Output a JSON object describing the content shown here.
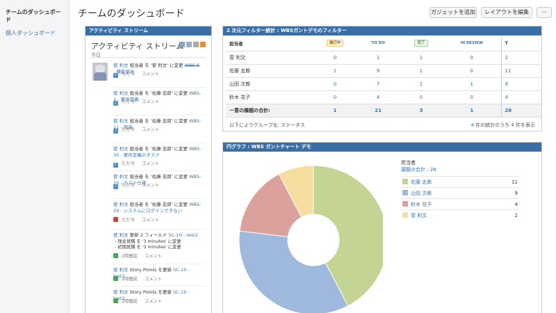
{
  "sidebar": {
    "items": [
      {
        "label": "チームのダッシュボード"
      },
      {
        "label": "個人ダッシュボード"
      }
    ]
  },
  "header": {
    "title": "チームのダッシュボード",
    "add_gadget_label": "ガジェットを追加",
    "edit_layout_label": "レイアウトを編集",
    "more_label": "···"
  },
  "activity": {
    "header": "アクティビティ ストリーム",
    "title": "アクティビティ ストリーム",
    "today": "今日",
    "icons": [
      "list-view-icon",
      "compact-view-icon",
      "settings-icon",
      "rss-feed-icon"
    ],
    "entries": [
      {
        "user": "菅 利文",
        "pre": " 担当者 を '菅 利文' に変更 ",
        "key": "WBS-6",
        "summary": " - 機能設計",
        "time": "ただ今",
        "comment": "コメント",
        "type": "task",
        "strike": true
      },
      {
        "user": "菅 利文",
        "pre": " 担当者 を '佐藤 志郎' に変更 ",
        "key": "WBS-1",
        "summary": " - 要件定義",
        "time": "ただ今",
        "comment": "コメント",
        "type": "task",
        "strike": false
      },
      {
        "user": "菅 利文",
        "pre": " 担当者 を '佐藤 志郎' に変更 ",
        "key": "WBS-11",
        "summary": " - 実装",
        "time": "ただ今",
        "comment": "コメント",
        "type": "task",
        "strike": false
      },
      {
        "user": "菅 利文",
        "pre": " 担当者 を '佐藤 志郎' に変更 ",
        "key": "WBS-30",
        "summary": " - 要件定義のタスク",
        "time": "ただ今",
        "comment": "コメント",
        "type": "task",
        "strike": false
      },
      {
        "user": "菅 利文",
        "pre": " 担当者 を '佐藤 志郎' に変更 ",
        "key": "WBS-16",
        "summary": " - テスト仕様",
        "time": "ただ今",
        "comment": "コメント",
        "type": "task",
        "strike": false
      },
      {
        "user": "菅 利文",
        "pre": " 担当者 を '佐藤 志郎' に変更 ",
        "key": "WBS-29",
        "summary": " - システムにログインできない",
        "time": "ただ今",
        "comment": "コメント",
        "type": "bug",
        "strike": false
      },
      {
        "user": "菅 利文",
        "pre": " 更新 2 フィールド ",
        "key": "SC-10 - test2",
        "summary": "",
        "bullets": [
          "残余見積 を '3 minutes' に変更",
          "初期見積 を '3 minutes' に変更"
        ],
        "time": "2時間前",
        "comment": "コメント",
        "type": "story",
        "strike": false
      },
      {
        "user": "菅 利文",
        "pre": " Story Points を更新 ",
        "key": "SC-10 - test2",
        "summary": "",
        "time": "2時間前",
        "comment": "コメント",
        "type": "story",
        "strike": false
      },
      {
        "user": "菅 利文",
        "pre": " Story Points を更新 ",
        "key": "SC-10 - test2",
        "summary": "",
        "time": "2時間前",
        "comment": "コメント",
        "type": "story",
        "strike": false
      }
    ]
  },
  "twod": {
    "header": "2 次元フィルター統計 : WBSガントデモのフィルター",
    "columns": [
      "担当者",
      "進行中",
      "TO DO",
      "完了",
      "IN REVIEW",
      "T"
    ],
    "rows": [
      {
        "name": "菅 利文",
        "values": [
          "0",
          "1",
          "1",
          "0",
          "2"
        ]
      },
      {
        "name": "佐藤 志郎",
        "values": [
          "1",
          "9",
          "1",
          "0",
          "11"
        ]
      },
      {
        "name": "山田 次郎",
        "values": [
          "0",
          "7",
          "1",
          "1",
          "9"
        ]
      },
      {
        "name": "鈴木 花子",
        "values": [
          "0",
          "4",
          "0",
          "0",
          "4"
        ]
      }
    ],
    "total_label": "一意の課題の合計:",
    "totals": [
      "1",
      "21",
      "3",
      "1",
      "26"
    ],
    "footer_left": "以下によりグループ化: ステータス",
    "footer_count": "4",
    "footer_right": " 件の統計のうち 4 件を表示"
  },
  "pie": {
    "header": "円グラフ : WBS ガントチャート デモ",
    "legend_title": "担当者",
    "total_text": "課題の合計 : 26",
    "colors": [
      "#c4d593",
      "#9fb8de",
      "#dba29d",
      "#f6dea0"
    ]
  },
  "chart_data": {
    "type": "pie",
    "title": "",
    "categories": [
      "佐藤 志郎",
      "山田 次郎",
      "鈴木 花子",
      "菅 利文"
    ],
    "values": [
      11,
      9,
      4,
      2
    ],
    "donut": true
  }
}
